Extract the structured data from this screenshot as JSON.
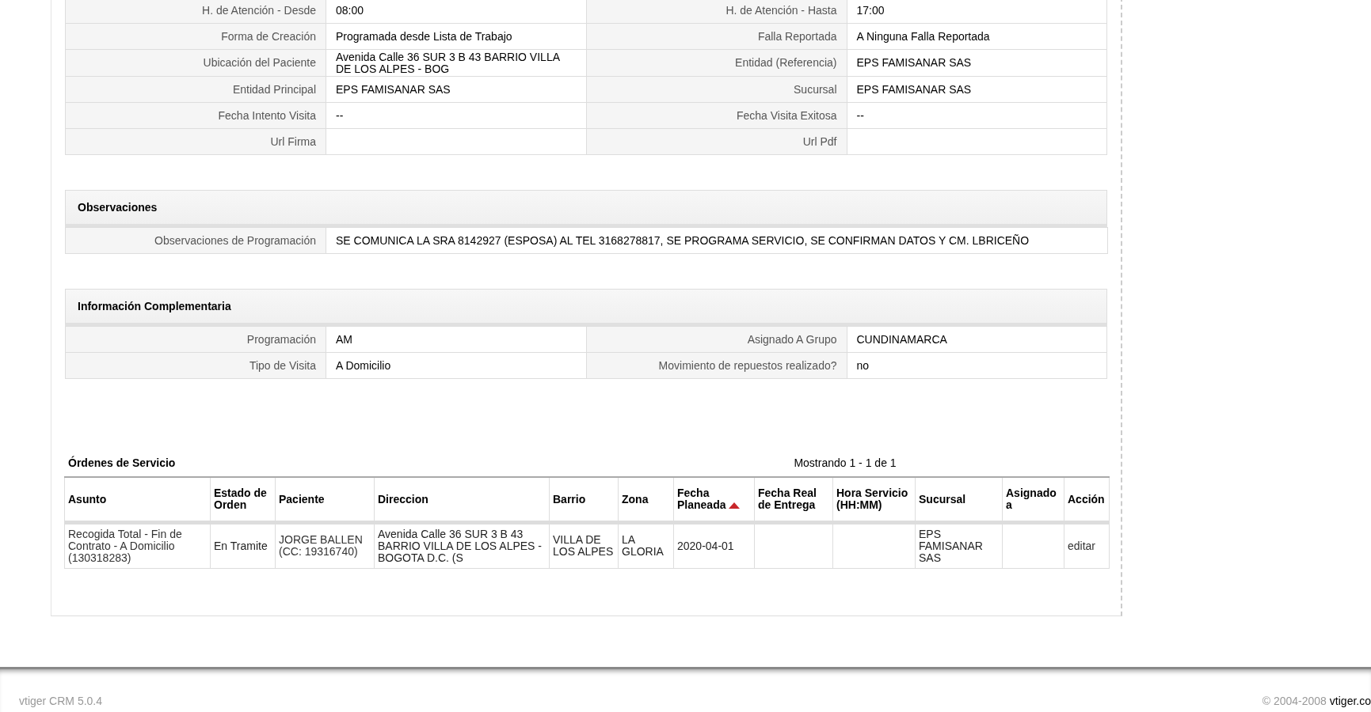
{
  "general_fields": [
    {
      "label": "H. de Atención - Desde",
      "value": "08:00"
    },
    {
      "label": "H. de Atención - Hasta",
      "value": "17:00"
    },
    {
      "label": "Forma de Creación",
      "value": "Programada desde Lista de Trabajo"
    },
    {
      "label": "Falla Reportada",
      "value": "A Ninguna Falla Reportada"
    },
    {
      "label": "Ubicación del Paciente",
      "value": "Avenida Calle 36 SUR 3 B 43 BARRIO VILLA DE LOS ALPES - BOG"
    },
    {
      "label": "Entidad (Referencia)",
      "value": "EPS FAMISANAR SAS"
    },
    {
      "label": "Entidad Principal",
      "value": "EPS FAMISANAR SAS"
    },
    {
      "label": "Sucursal",
      "value": "EPS FAMISANAR SAS"
    },
    {
      "label": "Fecha Intento Visita",
      "value": "--"
    },
    {
      "label": "Fecha Visita Exitosa",
      "value": "--"
    },
    {
      "label": "Url Firma"
    },
    {
      "label": "Url Pdf"
    }
  ],
  "observaciones": {
    "title": "Observaciones",
    "fields": [
      {
        "label": "Observaciones de Programación",
        "value": "SE COMUNICA LA SRA 8142927 (ESPOSA) AL TEL 3168278817, SE PROGRAMA SERVICIO, SE CONFIRMAN DATOS Y CM. LBRICEÑO"
      }
    ]
  },
  "informacion_complementaria": {
    "title": "Información Complementaria",
    "fields": [
      {
        "label": "Programación",
        "value": "AM"
      },
      {
        "label": "Asignado A Grupo",
        "value": "CUNDINAMARCA"
      },
      {
        "label": "Tipo de Visita",
        "value": "A Domicilio"
      },
      {
        "label": "Movimiento de repuestos realizado?",
        "value": "no"
      }
    ]
  },
  "ordenes_de_servicio": {
    "title": "Órdenes de Servicio",
    "pagination": "Mostrando 1 - 1 de 1",
    "columns": [
      {
        "label": "Asunto",
        "sorted": false
      },
      {
        "label": "Estado de Orden",
        "sorted": false
      },
      {
        "label": "Paciente",
        "sorted": false
      },
      {
        "label": "Direccion",
        "sorted": false
      },
      {
        "label": "Barrio",
        "sorted": false
      },
      {
        "label": "Zona",
        "sorted": false
      },
      {
        "label": "Fecha Planeada",
        "sorted": true
      },
      {
        "label": "Fecha Real de Entrega",
        "sorted": false
      },
      {
        "label": "Hora Servicio (HH:MM)",
        "sorted": false
      },
      {
        "label": "Sucursal",
        "sorted": false
      },
      {
        "label": "Asignado a",
        "sorted": false
      },
      {
        "label": "Acción",
        "sorted": false
      }
    ],
    "rows": [
      {
        "asunto": "Recogida Total - Fin de Contrato - A Domicilio (130318283)",
        "estado_de_orden": "En Tramite",
        "paciente": "JORGE BALLEN (CC: 19316740)",
        "direccion": "Avenida Calle 36 SUR 3 B 43 BARRIO VILLA DE LOS ALPES - BOGOTA D.C. (S",
        "barrio": "VILLA DE LOS ALPES",
        "zona": "LA GLORIA",
        "fecha_planeada": "2020-04-01",
        "sucursal": "EPS FAMISANAR SAS",
        "accion": "editar"
      }
    ]
  },
  "footer": {
    "version": "vtiger CRM 5.0.4",
    "copyright": "© 2004-2008",
    "link": "vtiger.co"
  }
}
